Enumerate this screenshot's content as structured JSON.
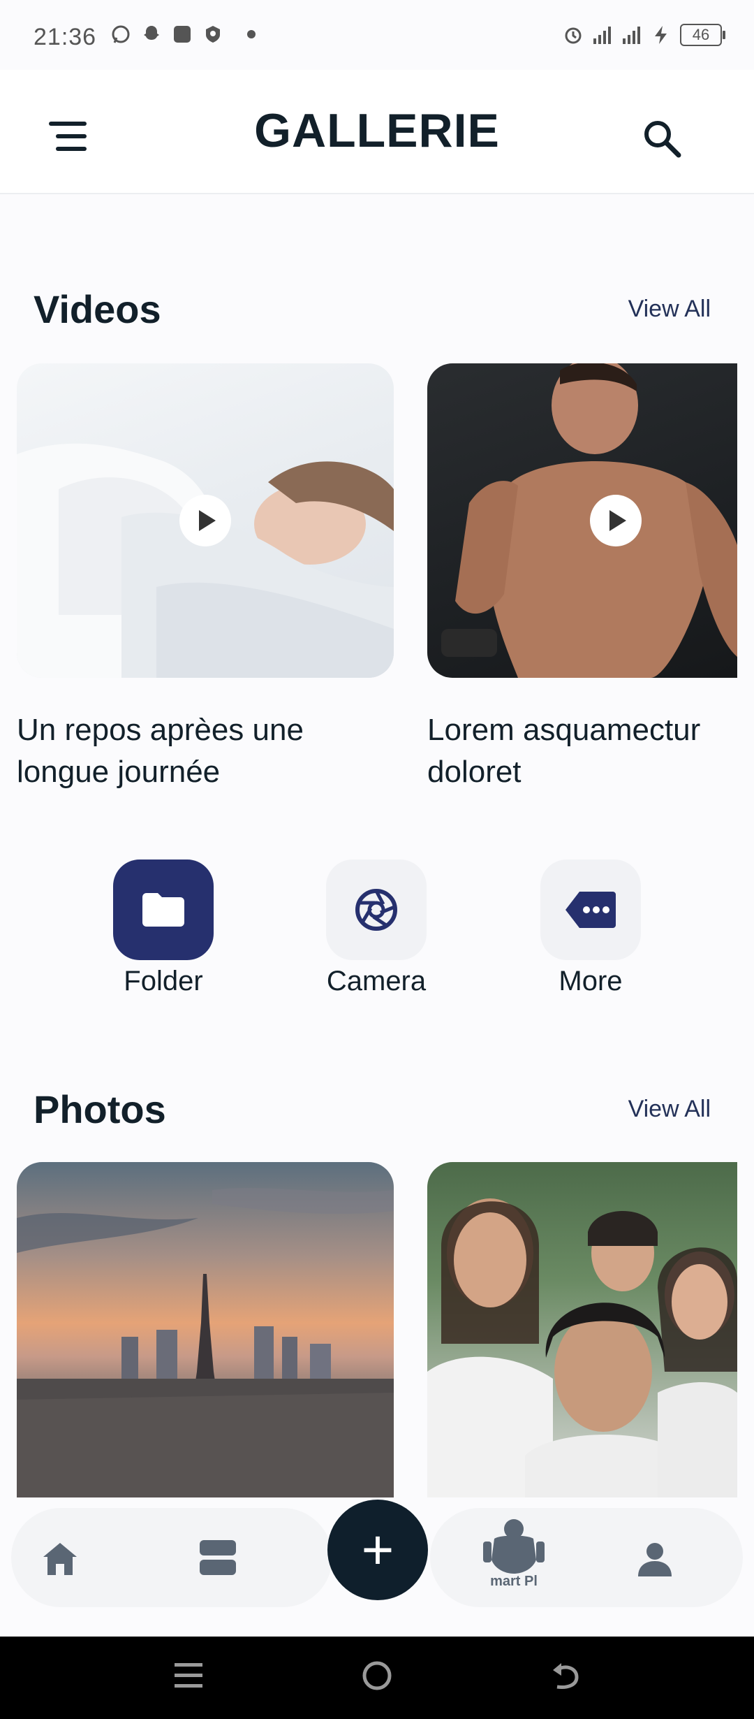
{
  "status_bar": {
    "time": "21:36",
    "battery": "46",
    "left_icons": [
      "whatsapp-icon",
      "snapchat-icon",
      "app-square-icon",
      "shield-icon",
      "dot-icon"
    ],
    "right_icons": [
      "alarm-icon",
      "signal-icon",
      "signal-icon",
      "charging-icon",
      "battery-icon"
    ]
  },
  "header": {
    "title": "GALLERIE",
    "menu_icon": "menu-icon",
    "search_icon": "search-icon"
  },
  "videos": {
    "title": "Videos",
    "view_all": "View All",
    "items": [
      {
        "caption_line1": "Un repos aprèes une",
        "caption_line2": "longue journée"
      },
      {
        "caption_line1": "Lorem asquamectur",
        "caption_line2": "doloret"
      }
    ]
  },
  "quick_actions": [
    {
      "label": "Folder",
      "icon": "folder-icon",
      "active": true
    },
    {
      "label": "Camera",
      "icon": "camera-aperture-icon",
      "active": false
    },
    {
      "label": "More",
      "icon": "more-tag-icon",
      "active": false
    }
  ],
  "photos": {
    "title": "Photos",
    "view_all": "View All"
  },
  "bottom_nav": {
    "items": [
      "home-icon",
      "grid-icon",
      "add-icon",
      "smart-play-icon",
      "profile-icon"
    ],
    "fab_label": "+",
    "smart_label": "mart Pl"
  },
  "colors": {
    "primary": "#26306e",
    "dark": "#0f1f2c",
    "text": "#12202a",
    "link": "#233158",
    "background": "#fbfbfd"
  }
}
